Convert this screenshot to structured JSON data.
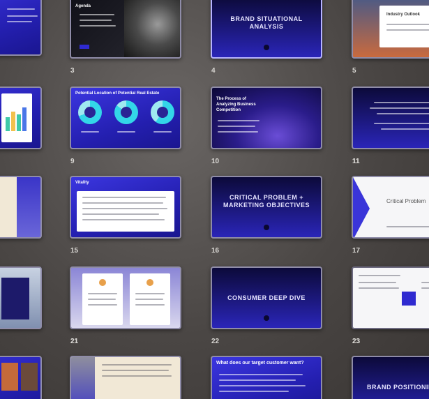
{
  "slides": [
    {
      "id": "s3",
      "number": "3",
      "title": "Agenda"
    },
    {
      "id": "s4",
      "number": "4",
      "title": "BRAND SITUATIONAL ANALYSIS"
    },
    {
      "id": "s5",
      "number": "5",
      "title": "Industry Outlook"
    },
    {
      "id": "s9",
      "number": "9",
      "title": "Potential Location of Potential Real Estate"
    },
    {
      "id": "s10",
      "number": "10",
      "title": "The Process of Analyzing Business Competition"
    },
    {
      "id": "s11",
      "number": "11",
      "title": ""
    },
    {
      "id": "s15",
      "number": "15",
      "title": "Vitality"
    },
    {
      "id": "s16",
      "number": "16",
      "title": "CRITICAL PROBLEM + MARKETING OBJECTIVES"
    },
    {
      "id": "s17",
      "number": "17",
      "title": "Critical Problem"
    },
    {
      "id": "s21",
      "number": "21",
      "title": ""
    },
    {
      "id": "s22",
      "number": "22",
      "title": "CONSUMER DEEP DIVE"
    },
    {
      "id": "s23",
      "number": "23",
      "title": ""
    },
    {
      "id": "s27",
      "number": "",
      "title": "What does our target customer want?"
    },
    {
      "id": "s28",
      "number": "",
      "title": "BRAND POSITIONING"
    }
  ],
  "colors": {
    "accent": "#2f2ad0",
    "background": "#4a4644"
  }
}
